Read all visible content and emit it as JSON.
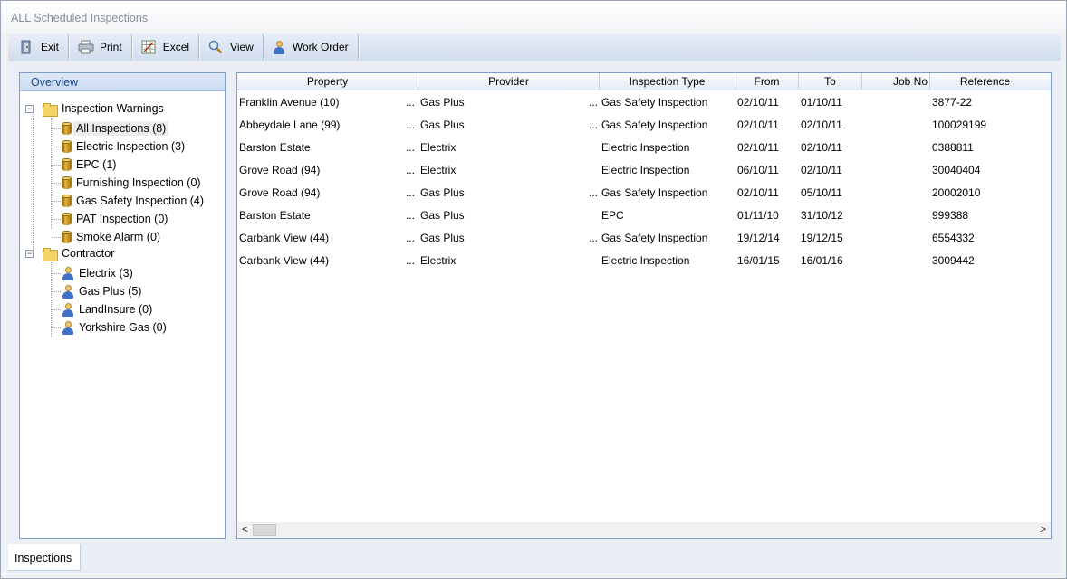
{
  "window": {
    "title": "ALL Scheduled Inspections"
  },
  "toolbar": {
    "buttons": [
      {
        "label": "Exit",
        "icon": "exit-door-icon"
      },
      {
        "label": "Print",
        "icon": "printer-icon"
      },
      {
        "label": "Excel",
        "icon": "excel-grid-icon"
      },
      {
        "label": "View",
        "icon": "magnifier-icon"
      },
      {
        "label": "Work Order",
        "icon": "person-icon"
      }
    ]
  },
  "overview": {
    "header": "Overview",
    "groups": [
      {
        "label": "Inspection Warnings",
        "items": [
          {
            "label": "All Inspections (8)",
            "selected": true
          },
          {
            "label": "Electric Inspection (3)"
          },
          {
            "label": "EPC (1)"
          },
          {
            "label": "Furnishing Inspection (0)"
          },
          {
            "label": "Gas Safety Inspection (4)"
          },
          {
            "label": "PAT Inspection (0)"
          },
          {
            "label": "Smoke Alarm (0)"
          }
        ]
      },
      {
        "label": "Contractor",
        "items": [
          {
            "label": "Electrix (3)"
          },
          {
            "label": "Gas Plus (5)"
          },
          {
            "label": "LandInsure (0)"
          },
          {
            "label": "Yorkshire Gas (0)"
          }
        ]
      }
    ]
  },
  "grid": {
    "columns": [
      "Property",
      "Provider",
      "Inspection Type",
      "From",
      "To",
      "Job No",
      "Reference"
    ],
    "rows": [
      {
        "property": "Franklin Avenue (10)",
        "provider": "Gas Plus",
        "type": "Gas Safety Inspection",
        "from": "02/10/11",
        "to": "01/10/11",
        "job": "",
        "reference": "3877-22",
        "ellipsis": [
          "...",
          "..."
        ]
      },
      {
        "property": "Abbeydale Lane (99)",
        "provider": "Gas Plus",
        "type": "Gas Safety Inspection",
        "from": "02/10/11",
        "to": "02/10/11",
        "job": "",
        "reference": "100029199",
        "ellipsis": [
          "...",
          "..."
        ]
      },
      {
        "property": "Barston Estate",
        "provider": "Electrix",
        "type": "Electric Inspection",
        "from": "02/10/11",
        "to": "02/10/11",
        "job": "",
        "reference": "0388811",
        "ellipsis": [
          "...",
          ""
        ]
      },
      {
        "property": "Grove Road (94)",
        "provider": "Electrix",
        "type": "Electric Inspection",
        "from": "06/10/11",
        "to": "02/10/11",
        "job": "",
        "reference": "30040404",
        "ellipsis": [
          "...",
          ""
        ]
      },
      {
        "property": "Grove Road (94)",
        "provider": "Gas Plus",
        "type": "Gas Safety Inspection",
        "from": "02/10/11",
        "to": "05/10/11",
        "job": "",
        "reference": "20002010",
        "ellipsis": [
          "...",
          "..."
        ]
      },
      {
        "property": "Barston Estate",
        "provider": "Gas Plus",
        "type": "EPC",
        "from": "01/11/10",
        "to": "31/10/12",
        "job": "",
        "reference": "999388",
        "ellipsis": [
          "...",
          ""
        ]
      },
      {
        "property": "Carbank View (44)",
        "provider": "Gas Plus",
        "type": "Gas Safety Inspection",
        "from": "19/12/14",
        "to": "19/12/15",
        "job": "",
        "reference": "6554332",
        "ellipsis": [
          "...",
          "..."
        ]
      },
      {
        "property": "Carbank View (44)",
        "provider": "Electrix",
        "type": "Electric Inspection",
        "from": "16/01/15",
        "to": "16/01/16",
        "job": "",
        "reference": "3009442",
        "ellipsis": [
          "...",
          ""
        ]
      }
    ]
  },
  "scroll": {
    "left_arrow": "<",
    "right_arrow": ">"
  },
  "tabs": [
    {
      "label": "Inspections"
    }
  ]
}
